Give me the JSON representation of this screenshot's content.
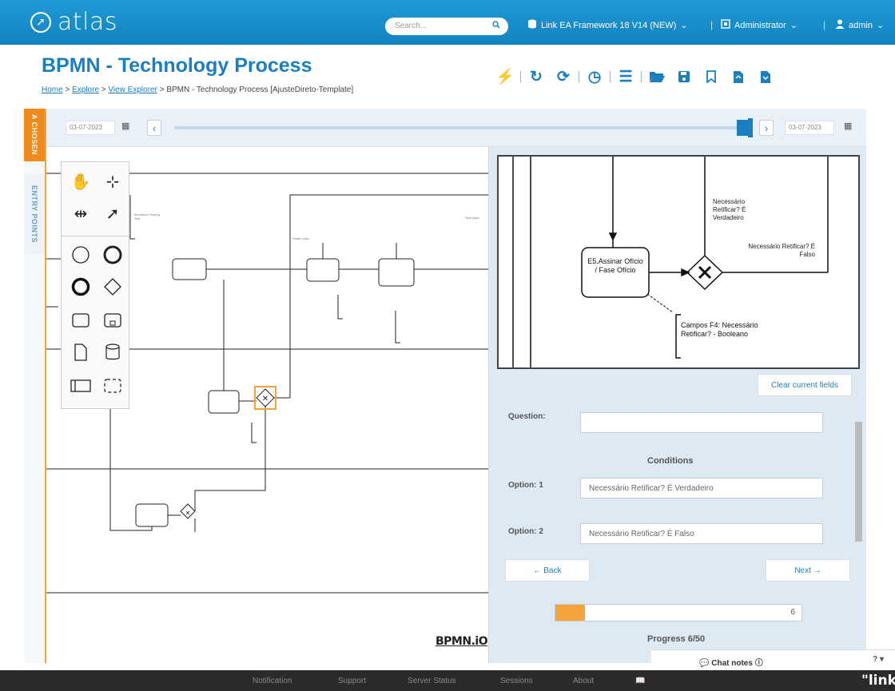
{
  "header": {
    "logo_text": "atlas",
    "search_placeholder": "Search...",
    "repository_label": "Link EA Framework 18 V14 (NEW)",
    "role_label": "Administrator",
    "user_label": "admin"
  },
  "page": {
    "title": "BPMN - Technology Process",
    "breadcrumb": {
      "home": "Home",
      "explore": "Explore",
      "view_explorer": "View Explorer",
      "current": "BPMN - Technology Process [AjusteDireto-Template]",
      "separator": ">"
    }
  },
  "toolbar": {
    "icons": [
      "bolt-icon",
      "refresh-icon",
      "refresh-alt-icon",
      "history-icon",
      "checklist-icon",
      "folder-open-icon",
      "save-icon",
      "bookmark-icon",
      "export-icon",
      "download-icon"
    ]
  },
  "left_rail": {
    "tab_active": "A CHOSEN",
    "tab_entry": "ENTRY POINTS"
  },
  "timeline": {
    "start_date": "03-07-2023",
    "end_date": "03-07-2023"
  },
  "canvas": {
    "watermark": "BPMN.iO",
    "palette_tools": [
      "hand-tool-icon",
      "lasso-tool-icon",
      "space-tool-icon",
      "connect-tool-icon",
      "start-event-icon",
      "intermediate-event-icon",
      "end-event-icon",
      "gateway-icon",
      "task-icon",
      "subprocess-icon",
      "data-object-icon",
      "data-store-icon",
      "pool-icon",
      "group-icon"
    ]
  },
  "preview": {
    "task_label": "E5.Assinar Ofício / Fase Ofício",
    "gateway_label_yes": "Necessário Retificar? É Verdadeiro",
    "gateway_label_no": "Necessário Retificar? É Falso",
    "annotation": "Campos F4: Necessário Retificar? - Booleano"
  },
  "form": {
    "clear_label": "Clear current fields",
    "question_label": "Question:",
    "question_value": "",
    "conditions_title": "Conditions",
    "option1_label": "Option: 1",
    "option1_value": "Necessário Retificar? É Verdadeiro",
    "option2_label": "Option: 2",
    "option2_value": "Necessário Retificar? É Falso",
    "back_label": "← Back",
    "next_label": "Next →",
    "progress_value": "6",
    "progress_fraction": 0.12,
    "progress_label": "Progress 6/50"
  },
  "chat": {
    "label": "Chat notes",
    "help": "?"
  },
  "footer": {
    "links": [
      "Notification",
      "Support",
      "Server Status",
      "Sessions",
      "About"
    ],
    "logo_text": "\"link"
  },
  "colors": {
    "brand_blue": "#1a7fc0",
    "accent_orange": "#f08a1c"
  }
}
